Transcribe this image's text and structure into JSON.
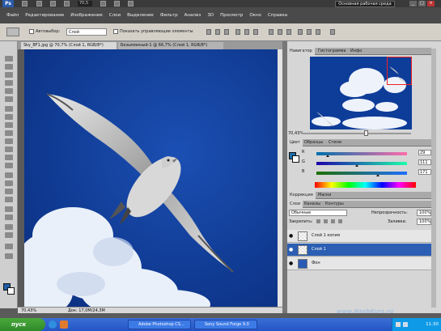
{
  "app": {
    "logo": "Ps",
    "zoom_value": "70,5",
    "workspace": "Основная рабочая среда",
    "window_buttons": [
      "_",
      "□",
      "×"
    ]
  },
  "menu": [
    "Файл",
    "Редактирование",
    "Изображение",
    "Слои",
    "Выделение",
    "Фильтр",
    "Анализ",
    "3D",
    "Просмотр",
    "Окно",
    "Справка"
  ],
  "options": {
    "autoselect_label": "Автовыбор:",
    "autoselect_value": "Слой",
    "show_controls_label": "Показать управляющие элементы"
  },
  "doc_tabs": [
    {
      "label": "Sky_BF1.jpg @ 70,7% (Слой 1, RGB/8*)",
      "active": true
    },
    {
      "label": "Безымянный-1 @ 66,7% (Слой 1, RGB/8*)",
      "active": false
    }
  ],
  "status": {
    "zoom": "70,43%",
    "doc": "Док: 17,0M/24,3M"
  },
  "navigator": {
    "tabs": [
      "Навигатор",
      "Гистограмма",
      "Инфо"
    ],
    "zoom": "70,43%"
  },
  "color_panel": {
    "tabs": [
      "Цвет",
      "Образцы",
      "Стили"
    ],
    "rows": [
      {
        "key": "R",
        "value": "29"
      },
      {
        "key": "G",
        "value": "111"
      },
      {
        "key": "B",
        "value": "171"
      }
    ],
    "fg_color": "#1d6eab",
    "bg_color": "#ffffff"
  },
  "adjust_panel": {
    "tabs": [
      "Коррекция",
      "Маски"
    ]
  },
  "layers_panel": {
    "tabs": [
      "Слои",
      "Каналы",
      "Контуры"
    ],
    "blend_mode": "Обычные",
    "opacity_label": "Непрозрачность:",
    "opacity_value": "100%",
    "lock_label": "Закрепить:",
    "fill_label": "Заливка:",
    "fill_value": "100%",
    "layers": [
      {
        "name": "Слой 1 копия",
        "selected": false
      },
      {
        "name": "Слой 1",
        "selected": true
      },
      {
        "name": "Фон",
        "selected": false
      }
    ]
  },
  "taskbar": {
    "start": "пуск",
    "items": [
      "Adobe Photoshop CS...",
      "Sony Sound Forge 9.0"
    ],
    "clock": "11:30"
  },
  "watermark": "www.NashKurs.ru",
  "colors": {
    "sky": "#0e3c99",
    "selection": "#2c5fb3",
    "accent_red": "#e22222"
  }
}
